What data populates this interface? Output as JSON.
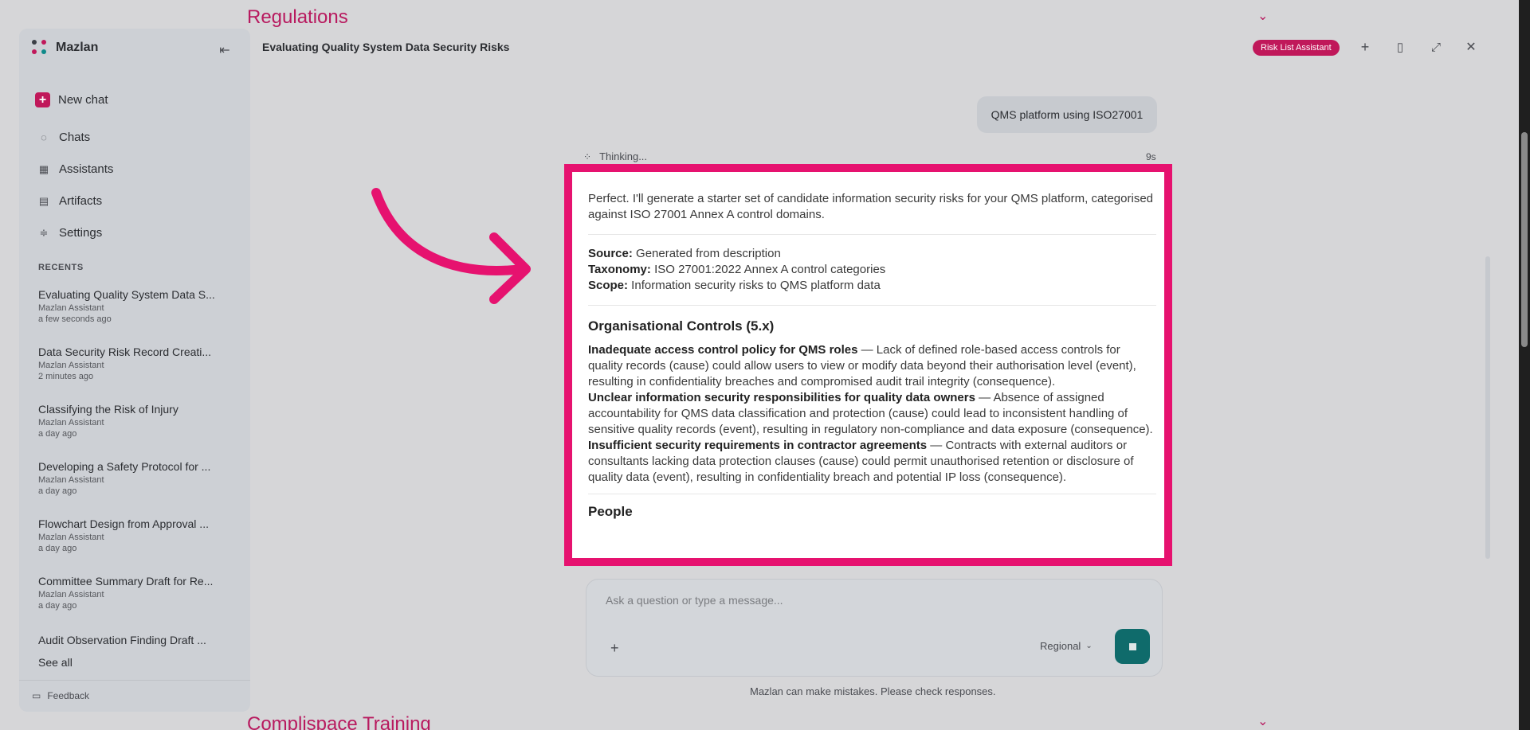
{
  "background": {
    "section_top": "Regulations",
    "section_bottom": "Complispace Training"
  },
  "sidebar": {
    "brand": "Mazlan",
    "new_chat": "New chat",
    "nav": [
      {
        "label": "Chats",
        "icon": "chat-icon"
      },
      {
        "label": "Assistants",
        "icon": "grid-icon"
      },
      {
        "label": "Artifacts",
        "icon": "document-icon"
      },
      {
        "label": "Settings",
        "icon": "sliders-icon"
      }
    ],
    "recents_heading": "RECENTS",
    "recents": [
      {
        "title": "Evaluating Quality System Data S...",
        "assistant": "Mazlan Assistant",
        "time": "a few seconds ago"
      },
      {
        "title": "Data Security Risk Record Creati...",
        "assistant": "Mazlan Assistant",
        "time": "2 minutes ago"
      },
      {
        "title": "Classifying the Risk of Injury",
        "assistant": "Mazlan Assistant",
        "time": "a day ago"
      },
      {
        "title": "Developing a Safety Protocol for ...",
        "assistant": "Mazlan Assistant",
        "time": "a day ago"
      },
      {
        "title": "Flowchart Design from Approval ...",
        "assistant": "Mazlan Assistant",
        "time": "a day ago"
      },
      {
        "title": "Committee Summary Draft for Re...",
        "assistant": "Mazlan Assistant",
        "time": "a day ago"
      },
      {
        "title": "Audit Observation Finding Draft ...",
        "assistant": "",
        "time": ""
      }
    ],
    "see_all": "See all",
    "feedback": "Feedback"
  },
  "chat": {
    "title": "Evaluating Quality System Data Security Risks",
    "assistant_badge": "Risk List Assistant",
    "user_message": "QMS platform using ISO27001",
    "thinking_label": "Thinking...",
    "thinking_time": "9s",
    "response": {
      "intro": "Perfect. I'll generate a starter set of candidate information security risks for your QMS platform, categorised against ISO 27001 Annex A control domains.",
      "source_label": "Source:",
      "source_value": " Generated from description",
      "taxonomy_label": "Taxonomy:",
      "taxonomy_value": " ISO 27001:2022 Annex A control categories",
      "scope_label": "Scope:",
      "scope_value": " Information security risks to QMS platform data",
      "section_heading": "Organisational Controls (5.x)",
      "risks": [
        {
          "title": "Inadequate access control policy for QMS roles",
          "text": " — Lack of defined role-based access controls for quality records (cause) could allow users to view or modify data beyond their authorisation level (event), resulting in confidentiality breaches and compromised audit trail integrity (consequence)."
        },
        {
          "title": "Unclear information security responsibilities for quality data owners",
          "text": " — Absence of assigned accountability for QMS data classification and protection (cause) could lead to inconsistent handling of sensitive quality records (event), resulting in regulatory non-compliance and data exposure (consequence)."
        },
        {
          "title": "Insufficient security requirements in contractor agreements",
          "text": " — Contracts with external auditors or consultants lacking data protection clauses (cause) could permit unauthorised retention or disclosure of quality data (event), resulting in confidentiality breach and potential IP loss (consequence)."
        }
      ],
      "next_heading": "People"
    }
  },
  "composer": {
    "placeholder": "Ask a question or type a message...",
    "region": "Regional",
    "disclaimer": "Mazlan can make mistakes. Please check responses."
  },
  "colors": {
    "accent": "#c0185a",
    "highlight": "#e6126f",
    "send": "#0f6b6b"
  }
}
